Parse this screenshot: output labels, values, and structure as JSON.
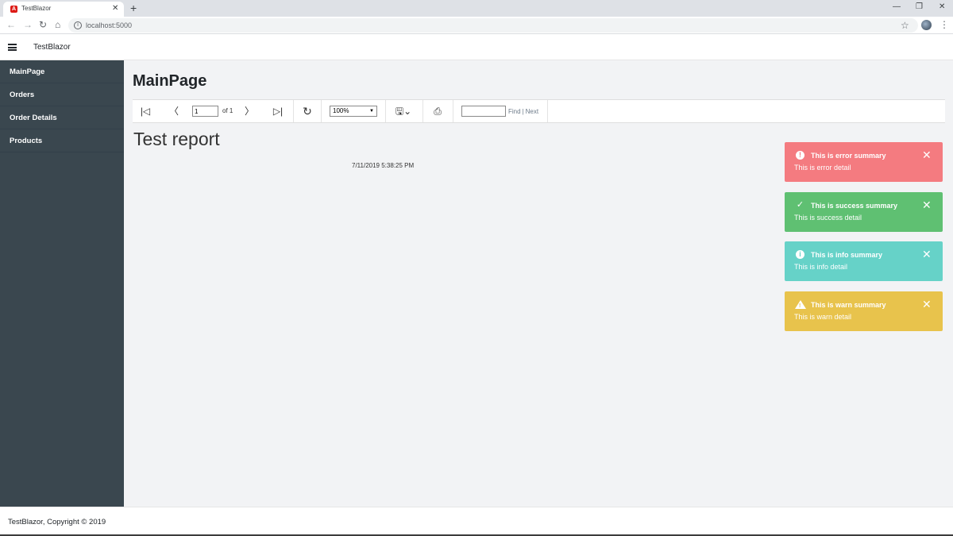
{
  "browser": {
    "tab_title": "TestBlazor",
    "tab_favicon": "A",
    "url": "localhost:5000",
    "icons": [
      "back-icon",
      "forward-icon",
      "reload-icon",
      "home-icon",
      "info-icon",
      "star-icon",
      "menu-dots-icon"
    ]
  },
  "header": {
    "brand": "TestBlazor"
  },
  "sidebar": {
    "items": [
      {
        "label": "MainPage"
      },
      {
        "label": "Orders"
      },
      {
        "label": "Order Details"
      },
      {
        "label": "Products"
      }
    ]
  },
  "main": {
    "title": "MainPage"
  },
  "report_viewer": {
    "page_value": "1",
    "page_of": "of 1",
    "zoom": "100%",
    "find_label": "Find",
    "next_label": "Next",
    "find_value": ""
  },
  "report": {
    "title": "Test report",
    "date": "7/11/2019 5:38:25 PM"
  },
  "toasts": [
    {
      "summary": "This is error summary",
      "detail": "This is error detail",
      "icon": "error-icon",
      "color": "#f47b80"
    },
    {
      "summary": "This is success summary",
      "detail": "This is success detail",
      "icon": "check-icon",
      "color": "#5fc072"
    },
    {
      "summary": "This is info summary",
      "detail": "This is info detail",
      "icon": "info-icon",
      "color": "#66d2c8"
    },
    {
      "summary": "This is warn summary",
      "detail": "This is warn detail",
      "icon": "warning-icon",
      "color": "#e8c34c"
    }
  ],
  "footer": {
    "text": "TestBlazor, Copyright © 2019"
  },
  "colors": {
    "sidebar_bg": "#3a474f",
    "content_bg": "#f2f3f5"
  }
}
